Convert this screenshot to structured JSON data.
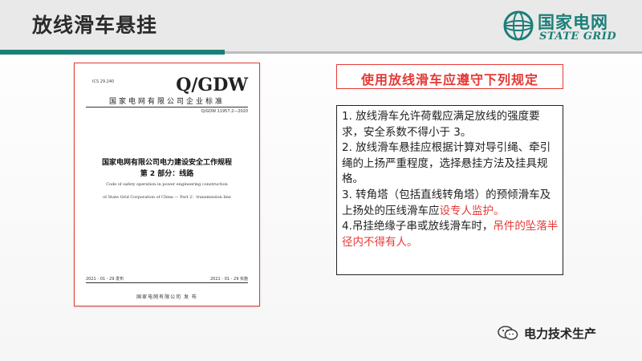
{
  "slide": {
    "title": "放线滑车悬挂"
  },
  "logo": {
    "icon": "state-grid-globe-icon",
    "cn": "国家电网",
    "en": "STATE GRID"
  },
  "document_cover": {
    "ics": "ICS 29.240",
    "standard_code": "Q/GDW",
    "organization": "国家电网有限公司企业标准",
    "number": "Q/GDW 11957.2—2020",
    "title_line1": "国家电网有限公司电力建设安全工作规程",
    "title_line2": "第 2 部分：线路",
    "en_line1": "Code of safety operation in power engineering construction",
    "en_line2": "of State Grid Corporation of China — Part 2：transmission line",
    "publish_date": "2021 - 01 - 29 发布",
    "implement_date": "2021 - 01 - 29 实施",
    "issuer": "国家电网有限公司    发 布"
  },
  "heading": "使用放线滑车应遵守下列规定",
  "rules": {
    "r1": "1. 放线滑车允许荷载应满足放线的强度要求，安全系数不得小于 3。",
    "r2": "2. 放线滑车悬挂应根据计算对导引绳、牵引绳的上扬严重程度，选择悬挂方法及挂具规格。",
    "r3_normal": "3. 转角塔（包括直线转角塔）的预倾滑车及上扬处的压线滑车应",
    "r3_red": "设专人监护。",
    "r4_normal": "4.吊挂绝缘子串或放线滑车时，",
    "r4_red": "吊件的坠落半径内不得有人。"
  },
  "footer": {
    "icon": "wechat-icon",
    "label": "电力技术生产"
  },
  "colors": {
    "accent": "#1a7f78",
    "red": "#e53935"
  }
}
